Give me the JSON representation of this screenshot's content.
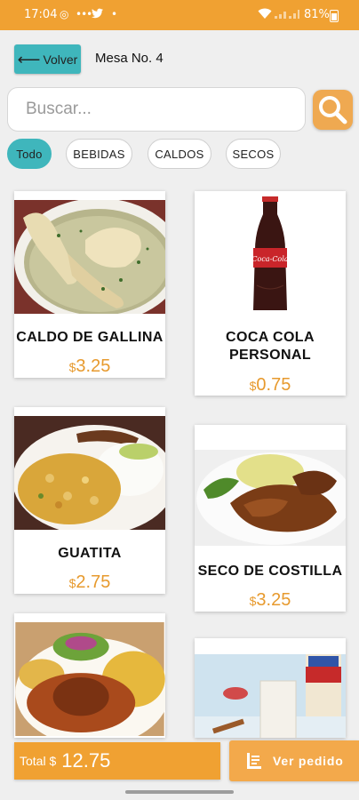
{
  "status_bar": {
    "time": "17:04",
    "battery": "81%"
  },
  "header": {
    "back_label": "Volver",
    "table_label": "Mesa No. 4"
  },
  "search": {
    "placeholder": "Buscar..."
  },
  "categories": [
    {
      "label": "Todo",
      "active": true
    },
    {
      "label": "BEBIDAS",
      "active": false
    },
    {
      "label": "CALDOS",
      "active": false
    },
    {
      "label": "SECOS",
      "active": false
    }
  ],
  "currency_symbol": "$",
  "products": [
    {
      "name": "CALDO DE GALLINA",
      "price": "3.25"
    },
    {
      "name": "COCA COLA PERSONAL",
      "price": "0.75"
    },
    {
      "name": "GUATITA",
      "price": "2.75"
    },
    {
      "name": "SECO DE COSTILLA",
      "price": "3.25"
    },
    {
      "name": "",
      "price": ""
    },
    {
      "name": "",
      "price": ""
    }
  ],
  "footer": {
    "total_label": "Total $",
    "total_value": "12.75",
    "view_order_label": "Ver pedido"
  },
  "colors": {
    "primary": "#f0a132",
    "accent": "#3fb6bc",
    "price": "#e79a2e",
    "background": "#efefef"
  }
}
